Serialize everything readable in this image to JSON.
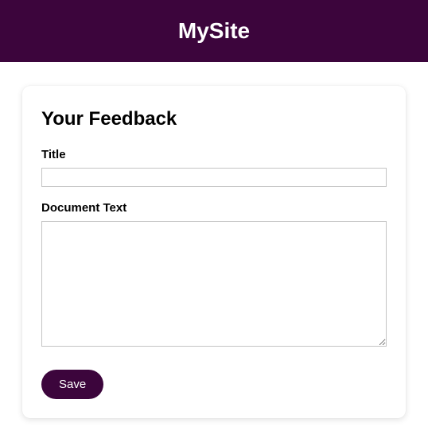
{
  "header": {
    "site_title": "MySite"
  },
  "card": {
    "heading": "Your Feedback",
    "fields": {
      "title": {
        "label": "Title",
        "value": ""
      },
      "document_text": {
        "label": "Document Text",
        "value": ""
      }
    },
    "save_label": "Save"
  },
  "colors": {
    "brand": "#3c053c"
  }
}
